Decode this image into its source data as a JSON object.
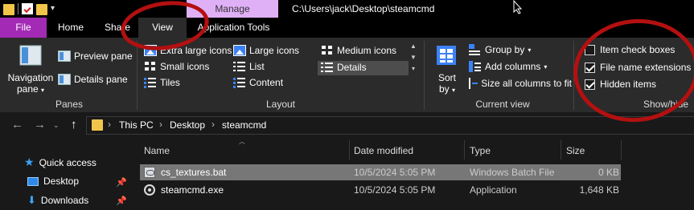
{
  "window": {
    "path": "C:\\Users\\jack\\Desktop\\steamcmd",
    "context_tab": "Manage"
  },
  "tabs": {
    "file": "File",
    "home": "Home",
    "share": "Share",
    "view": "View",
    "app_tools": "Application Tools"
  },
  "ribbon": {
    "panes": {
      "label": "Panes",
      "navigation_pane": "Navigation",
      "navigation_pane_2": "pane",
      "preview_pane": "Preview pane",
      "details_pane": "Details pane"
    },
    "layout": {
      "label": "Layout",
      "extra_large_icons": "Extra large icons",
      "large_icons": "Large icons",
      "medium_icons": "Medium icons",
      "small_icons": "Small icons",
      "list": "List",
      "details": "Details",
      "tiles": "Tiles",
      "content": "Content"
    },
    "current_view": {
      "label": "Current view",
      "sort_by": "Sort",
      "sort_by_2": "by",
      "group_by": "Group by",
      "add_columns": "Add columns",
      "size_all_columns": "Size all columns to fit"
    },
    "show_hide": {
      "label": "Show/hide",
      "item_check_boxes": "Item check boxes",
      "item_check_boxes_checked": false,
      "file_name_extensions": "File name extensions",
      "file_name_extensions_checked": true,
      "hidden_items": "Hidden items",
      "hidden_items_checked": true
    }
  },
  "address": {
    "crumbs": [
      "This PC",
      "Desktop",
      "steamcmd"
    ]
  },
  "nav_pane": {
    "quick_access": "Quick access",
    "desktop": "Desktop",
    "downloads": "Downloads"
  },
  "columns": {
    "name": "Name",
    "date_modified": "Date modified",
    "type": "Type",
    "size": "Size"
  },
  "files": [
    {
      "name": "cs_textures.bat",
      "date": "10/5/2024 5:05 PM",
      "type": "Windows Batch File",
      "size": "0 KB",
      "icon": "batch-file-icon",
      "selected": true
    },
    {
      "name": "steamcmd.exe",
      "date": "10/5/2024 5:05 PM",
      "type": "Application",
      "size": "1,648 KB",
      "icon": "steam-icon",
      "selected": false
    }
  ],
  "colors": {
    "file_tab": "#a32ab4",
    "manage_tab": "#e0b0f7",
    "annotation": "#b31010",
    "ribbon_bg": "#2b2b2b"
  }
}
